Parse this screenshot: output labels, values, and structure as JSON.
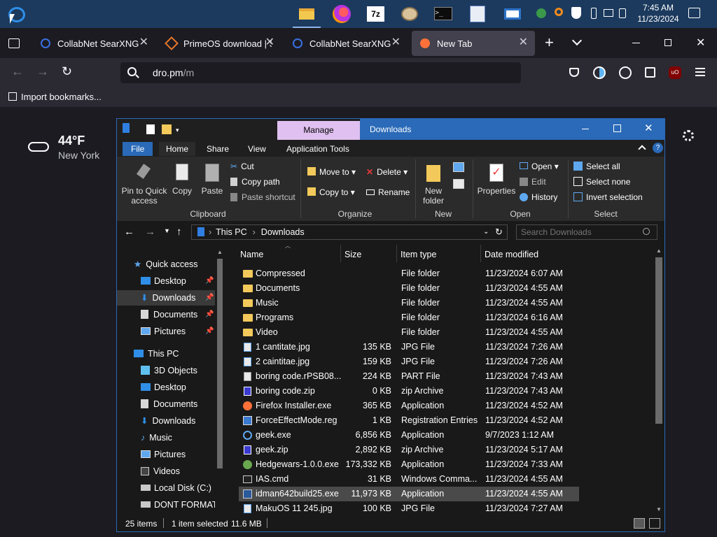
{
  "taskbar": {
    "clock_time": "7:45 AM",
    "clock_date": "11/23/2024",
    "apps": [
      "file-explorer",
      "firefox",
      "7zip",
      "paint-palette",
      "terminal",
      "text-editor",
      "app-window"
    ]
  },
  "browser": {
    "tabs": [
      {
        "title": "CollabNet SearXNG"
      },
      {
        "title": "PrimeOS download | Sc"
      },
      {
        "title": "CollabNet SearXNG"
      },
      {
        "title": "New Tab"
      }
    ],
    "url_domain": "dro.pm",
    "url_path": "/m",
    "import_bookmarks": "Import bookmarks...",
    "extension_badge": "uO"
  },
  "weather": {
    "temp": "44°F",
    "city": "New York"
  },
  "explorer": {
    "title": "Downloads",
    "manage": "Manage",
    "ribbon_tabs": [
      "File",
      "Home",
      "Share",
      "View",
      "Application Tools"
    ],
    "clipboard": {
      "pin_line1": "Pin to Quick",
      "pin_line2": "access",
      "copy": "Copy",
      "paste": "Paste",
      "cut": "Cut",
      "copy_path": "Copy path",
      "paste_shortcut": "Paste shortcut",
      "group": "Clipboard"
    },
    "organize": {
      "move_to": "Move to",
      "copy_to": "Copy to",
      "delete": "Delete",
      "rename": "Rename",
      "group": "Organize"
    },
    "new": {
      "new_folder_line1": "New",
      "new_folder_line2": "folder",
      "group": "New"
    },
    "open": {
      "properties": "Properties",
      "open": "Open",
      "edit": "Edit",
      "history": "History",
      "group": "Open"
    },
    "select": {
      "select_all": "Select all",
      "select_none": "Select none",
      "invert": "Invert selection",
      "group": "Select"
    },
    "breadcrumb": [
      "This PC",
      "Downloads"
    ],
    "search_placeholder": "Search Downloads",
    "columns": {
      "name": "Name",
      "size": "Size",
      "type": "Item type",
      "date": "Date modified"
    },
    "sidebar": [
      {
        "label": "Quick access"
      },
      {
        "label": "Desktop"
      },
      {
        "label": "Downloads"
      },
      {
        "label": "Documents"
      },
      {
        "label": "Pictures"
      },
      {
        "label": "This PC"
      },
      {
        "label": "3D Objects"
      },
      {
        "label": "Desktop"
      },
      {
        "label": "Documents"
      },
      {
        "label": "Downloads"
      },
      {
        "label": "Music"
      },
      {
        "label": "Pictures"
      },
      {
        "label": "Videos"
      },
      {
        "label": "Local Disk (C:)"
      },
      {
        "label": "DONT FORMAT ("
      }
    ],
    "files": [
      {
        "name": "Compressed",
        "size": "",
        "type": "File folder",
        "date": "11/23/2024 6:07 AM"
      },
      {
        "name": "Documents",
        "size": "",
        "type": "File folder",
        "date": "11/23/2024 4:55 AM"
      },
      {
        "name": "Music",
        "size": "",
        "type": "File folder",
        "date": "11/23/2024 4:55 AM"
      },
      {
        "name": "Programs",
        "size": "",
        "type": "File folder",
        "date": "11/23/2024 6:16 AM"
      },
      {
        "name": "Video",
        "size": "",
        "type": "File folder",
        "date": "11/23/2024 4:55 AM"
      },
      {
        "name": "1 cantitate.jpg",
        "size": "135 KB",
        "type": "JPG File",
        "date": "11/23/2024 7:26 AM"
      },
      {
        "name": "2 caintitae.jpg",
        "size": "159 KB",
        "type": "JPG File",
        "date": "11/23/2024 7:26 AM"
      },
      {
        "name": "boring code.rPSB08...",
        "size": "224 KB",
        "type": "PART File",
        "date": "11/23/2024 7:43 AM"
      },
      {
        "name": "boring code.zip",
        "size": "0 KB",
        "type": "zip Archive",
        "date": "11/23/2024 7:43 AM"
      },
      {
        "name": "Firefox Installer.exe",
        "size": "365 KB",
        "type": "Application",
        "date": "11/23/2024 4:52 AM"
      },
      {
        "name": "ForceEffectMode.reg",
        "size": "1 KB",
        "type": "Registration Entries",
        "date": "11/23/2024 4:52 AM"
      },
      {
        "name": "geek.exe",
        "size": "6,856 KB",
        "type": "Application",
        "date": "9/7/2023 1:12 AM"
      },
      {
        "name": "geek.zip",
        "size": "2,892 KB",
        "type": "zip Archive",
        "date": "11/23/2024 5:17 AM"
      },
      {
        "name": "Hedgewars-1.0.0.exe",
        "size": "173,332 KB",
        "type": "Application",
        "date": "11/23/2024 7:33 AM"
      },
      {
        "name": "IAS.cmd",
        "size": "31 KB",
        "type": "Windows Comma...",
        "date": "11/23/2024 4:55 AM"
      },
      {
        "name": "idman642build25.exe",
        "size": "11,973 KB",
        "type": "Application",
        "date": "11/23/2024 4:55 AM"
      },
      {
        "name": "MakuOS 11 245.jpg",
        "size": "100 KB",
        "type": "JPG File",
        "date": "11/23/2024 7:27 AM"
      }
    ],
    "status": {
      "count": "25 items",
      "selected": "1 item selected",
      "size": "11.6 MB"
    }
  }
}
